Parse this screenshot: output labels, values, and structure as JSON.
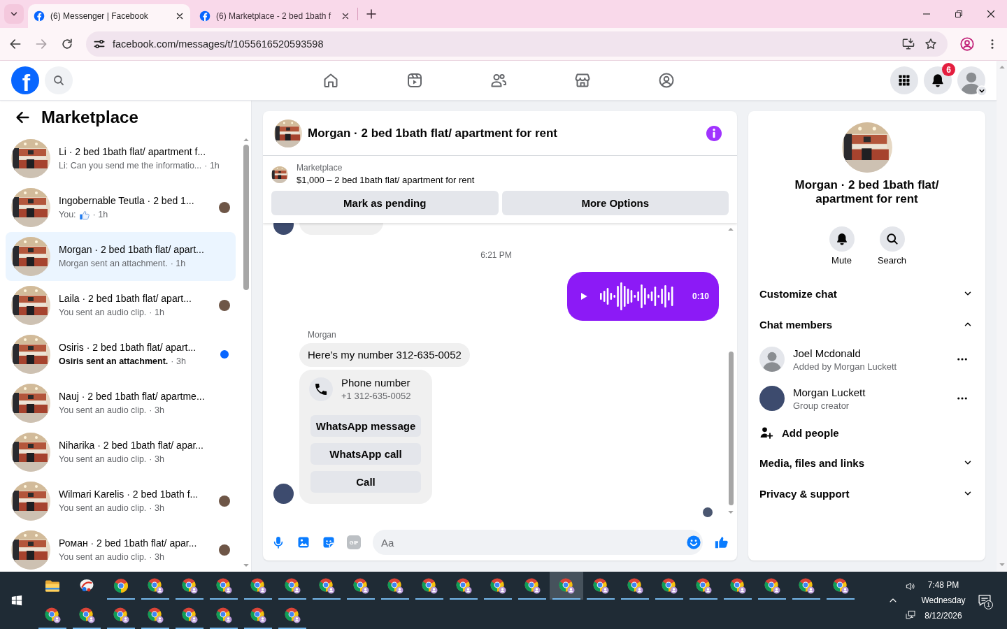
{
  "browser": {
    "tabs": [
      {
        "title": "(6) Messenger | Facebook",
        "selected": true
      },
      {
        "title": "(6) Marketplace - 2 bed 1bath f",
        "selected": false
      }
    ],
    "forward_disabled": true,
    "url": "facebook.com/messages/t/1055616520593598"
  },
  "topbar": {
    "logo": "f",
    "nav": [
      {
        "kind": "home",
        "selected": false
      },
      {
        "kind": "video",
        "selected": false
      },
      {
        "kind": "friends",
        "selected": false
      },
      {
        "kind": "store",
        "selected": false
      },
      {
        "kind": "gaming",
        "selected": false
      }
    ],
    "notification_count": "6"
  },
  "sidebar": {
    "title": "Marketplace",
    "conversations": [
      {
        "name": "Li · 2 bed 1bath flat/ apartment f...",
        "kind": "text",
        "preview": "Li: Can you send me the informatio...",
        "time": "· 1h",
        "selected": false,
        "unread": false,
        "seen": false
      },
      {
        "name": "Ingobernable Teutla · 2 bed 1...",
        "kind": "like",
        "preview": "You:",
        "time": "· 1h",
        "selected": false,
        "unread": false,
        "seen": true
      },
      {
        "name": "Morgan · 2 bed 1bath flat/ apart...",
        "kind": "text",
        "preview": "Morgan sent an attachment.",
        "time": "· 1h",
        "selected": true,
        "unread": false,
        "seen": false
      },
      {
        "name": "Laila · 2 bed 1bath flat/ apart...",
        "kind": "text",
        "preview": "You sent an audio clip.",
        "time": "· 1h",
        "selected": false,
        "unread": false,
        "seen": true
      },
      {
        "name": "Osiris · 2 bed 1bath flat/ apart...",
        "kind": "text",
        "preview": "Osiris sent an attachment.",
        "time": "· 3h",
        "selected": false,
        "unread": true,
        "seen": false
      },
      {
        "name": "Nauj · 2 bed 1bath flat/ apartme...",
        "kind": "text",
        "preview": "You sent an audio clip.",
        "time": "· 3h",
        "selected": false,
        "unread": false,
        "seen": false
      },
      {
        "name": "Niharika · 2 bed 1bath flat/ apar...",
        "kind": "text",
        "preview": "You sent an audio clip.",
        "time": "· 3h",
        "selected": false,
        "unread": false,
        "seen": false
      },
      {
        "name": "Wilmari Karelis · 2 bed 1bath f...",
        "kind": "text",
        "preview": "You sent an audio clip.",
        "time": "· 3h",
        "selected": false,
        "unread": false,
        "seen": true
      },
      {
        "name": "Роман · 2 bed 1bath flat/ apar...",
        "kind": "text",
        "preview": "You sent an audio clip.",
        "time": "· 3h",
        "selected": false,
        "unread": false,
        "seen": true
      }
    ]
  },
  "chat": {
    "title": "Morgan · 2 bed 1bath flat/ apartment for rent",
    "listing": {
      "source": "Marketplace",
      "summary": "$1,000 – 2 bed 1bath flat/ apartment for rent",
      "actions": [
        "Mark as pending",
        "More Options"
      ]
    },
    "messages": [
      {
        "kind": "clipped"
      },
      {
        "kind": "timestamp",
        "text": "6:21 PM"
      },
      {
        "kind": "audio",
        "duration": "0:10"
      },
      {
        "kind": "incoming",
        "sender": "Morgan",
        "text": "Here’s my number 312-635-0052",
        "card": {
          "title": "Phone number",
          "number": "+1 312-635-0052",
          "actions": [
            "WhatsApp message",
            "WhatsApp call",
            "Call"
          ]
        }
      },
      {
        "kind": "seen"
      }
    ],
    "composer": {
      "gif": "GIF",
      "placeholder": "Aa"
    }
  },
  "info": {
    "title": "Morgan · 2 bed 1bath flat/ apartment for rent",
    "actions": [
      {
        "kind": "mute",
        "label": "Mute"
      },
      {
        "kind": "search",
        "label": "Search"
      }
    ],
    "sections": [
      {
        "label": "Customize chat",
        "expanded": false
      },
      {
        "label": "Chat members",
        "expanded": true,
        "members": [
          {
            "name": "Joel Mcdonald",
            "role": "Added by Morgan Luckett",
            "kind": "default"
          },
          {
            "name": "Morgan Luckett",
            "role": "Group creator",
            "kind": "photo"
          }
        ],
        "add_label": "Add people"
      },
      {
        "label": "Media, files and links",
        "expanded": false
      },
      {
        "label": "Privacy & support",
        "expanded": false
      }
    ]
  },
  "taskbar": {
    "apps": [
      {
        "kind": "folder",
        "running": false,
        "selected": false
      },
      {
        "kind": "tool",
        "running": false,
        "selected": false
      },
      {
        "kind": "browser",
        "running": true,
        "selected": false
      },
      {
        "kind": "browser_profile",
        "running": true,
        "selected": false
      },
      {
        "kind": "browser_profile",
        "running": true,
        "selected": false
      },
      {
        "kind": "browser_profile",
        "running": true,
        "selected": false
      },
      {
        "kind": "browser_profile",
        "running": true,
        "selected": false
      },
      {
        "kind": "browser_profile",
        "running": true,
        "selected": false
      },
      {
        "kind": "browser_profile",
        "running": true,
        "selected": false
      },
      {
        "kind": "browser_profile",
        "running": true,
        "selected": false
      },
      {
        "kind": "browser_profile",
        "running": true,
        "selected": false
      },
      {
        "kind": "browser_profile",
        "running": true,
        "selected": false
      },
      {
        "kind": "browser_profile",
        "running": true,
        "selected": false
      },
      {
        "kind": "browser_profile",
        "running": true,
        "selected": false
      },
      {
        "kind": "browser_profile",
        "running": true,
        "selected": false
      },
      {
        "kind": "browser_profile",
        "running": true,
        "selected": true
      },
      {
        "kind": "browser_profile",
        "running": true,
        "selected": false
      },
      {
        "kind": "browser_profile",
        "running": true,
        "selected": false
      },
      {
        "kind": "browser_profile",
        "running": true,
        "selected": false
      },
      {
        "kind": "browser_profile",
        "running": true,
        "selected": false
      },
      {
        "kind": "browser_profile",
        "running": true,
        "selected": false
      },
      {
        "kind": "browser_profile",
        "running": true,
        "selected": false
      },
      {
        "kind": "browser_profile",
        "running": true,
        "selected": false
      },
      {
        "kind": "browser_profile",
        "running": true,
        "selected": false
      },
      {
        "kind": "browser_profile",
        "running": true,
        "selected": false
      },
      {
        "kind": "browser_profile",
        "running": true,
        "selected": false
      },
      {
        "kind": "browser_profile",
        "running": true,
        "selected": false
      },
      {
        "kind": "browser_profile",
        "running": true,
        "selected": false
      },
      {
        "kind": "browser_profile",
        "running": true,
        "selected": false
      },
      {
        "kind": "browser_profile",
        "running": true,
        "selected": false
      },
      {
        "kind": "browser_profile",
        "running": true,
        "selected": false
      },
      {
        "kind": "browser_profile",
        "running": true,
        "selected": false
      }
    ],
    "clock": {
      "time": "7:48 PM",
      "day": "Wednesday",
      "date": "8/12/2026"
    },
    "notification_count": "1"
  }
}
